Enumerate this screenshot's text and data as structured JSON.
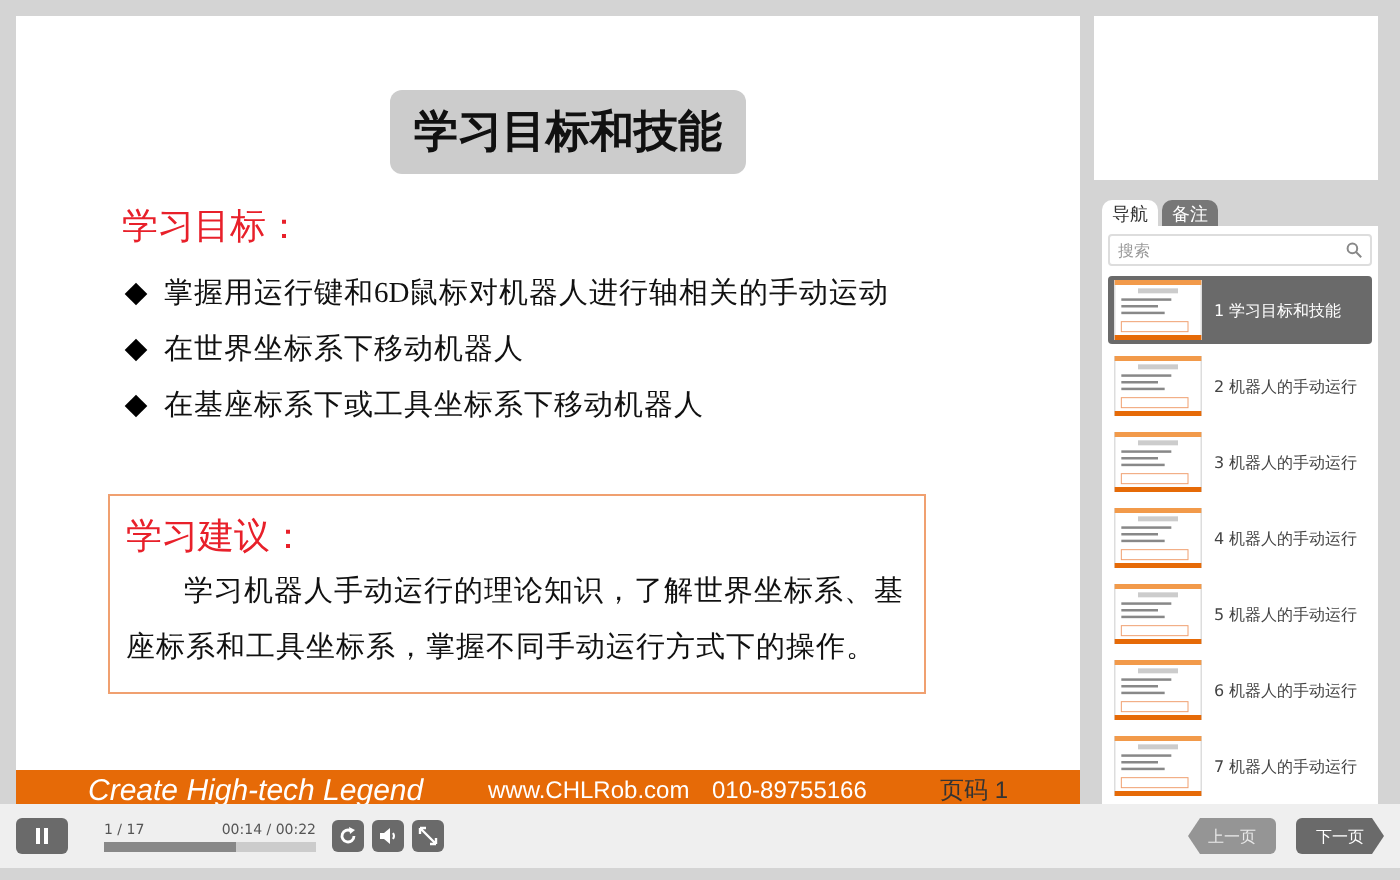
{
  "slide": {
    "title": "学习目标和技能",
    "goals_heading": "学习目标：",
    "goals": [
      "掌握用运行键和6D鼠标对机器人进行轴相关的手动运动",
      "在世界坐标系下移动机器人",
      "在基座标系下或工具坐标系下移动机器人"
    ],
    "advice_heading": "学习建议：",
    "advice": "学习机器人手动运行的理论知识，了解世界坐标系、基座标系和工具坐标系，掌握不同手动运行方式下的操作。",
    "footer": {
      "slogan": "Create High-tech Legend",
      "website": "www.CHLRob.com",
      "phone": "010-89755166",
      "page": "页码 1"
    }
  },
  "sidebar": {
    "tabs": [
      {
        "label": "导航",
        "selected": true
      },
      {
        "label": "备注",
        "selected": false
      }
    ],
    "search": {
      "placeholder": "搜索"
    },
    "slides": [
      {
        "label": "1 学习目标和技能",
        "selected": true
      },
      {
        "label": "2 机器人的手动运行",
        "selected": false
      },
      {
        "label": "3 机器人的手动运行",
        "selected": false
      },
      {
        "label": "4 机器人的手动运行",
        "selected": false
      },
      {
        "label": "5 机器人的手动运行",
        "selected": false
      },
      {
        "label": "6 机器人的手动运行",
        "selected": false
      },
      {
        "label": "7 机器人的手动运行",
        "selected": false
      }
    ]
  },
  "controls": {
    "playing": true,
    "slide_counter": "1 / 17",
    "time": "00:14 / 00:22",
    "level": 0.62,
    "prev": {
      "label": "上一页",
      "disabled": true
    },
    "next": {
      "label": "下一页",
      "disabled": false
    }
  }
}
